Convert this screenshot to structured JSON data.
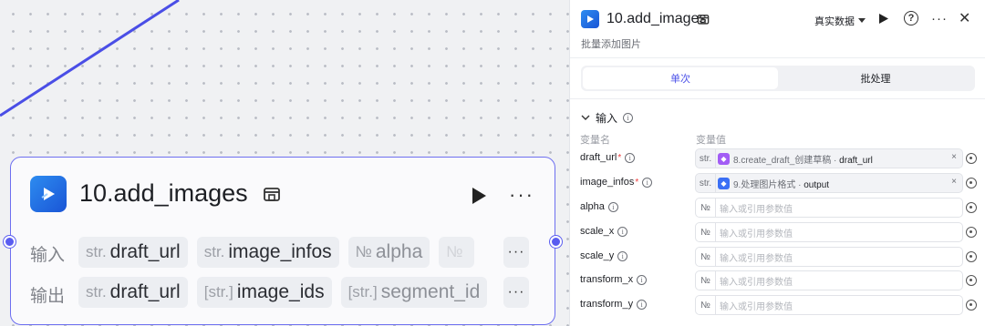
{
  "node": {
    "title": "10.add_images",
    "more": "···",
    "input_label": "输入",
    "output_label": "输出",
    "inputs": [
      {
        "type": "str.",
        "name": "draft_url"
      },
      {
        "type": "str.",
        "name": "image_infos"
      },
      {
        "type": "№",
        "name": "alpha"
      },
      {
        "type": "№",
        "name": ""
      }
    ],
    "outputs": [
      {
        "type": "str.",
        "name": "draft_url"
      },
      {
        "type": "[str.]",
        "name": "image_ids"
      },
      {
        "type": "[str.]",
        "name": "segment_id"
      }
    ],
    "row_more": "···"
  },
  "panel": {
    "title": "10.add_images",
    "subtitle": "批量添加图片",
    "data_source": "真实数据",
    "help": "?",
    "more": "···",
    "close": "✕",
    "tabs": [
      {
        "label": "单次",
        "active": true
      },
      {
        "label": "批处理",
        "active": false
      }
    ],
    "section": "输入",
    "col_name": "变量名",
    "col_value": "变量值",
    "params": [
      {
        "name": "draft_url",
        "required": true,
        "type": "str.",
        "ref_node": "8.create_draft_创建草稿",
        "ref_sep": "·",
        "ref_field": "draft_url",
        "ref_color": "#a25cf5",
        "clear": "×"
      },
      {
        "name": "image_infos",
        "required": true,
        "type": "str.",
        "ref_node": "9.处理图片格式",
        "ref_sep": "·",
        "ref_field": "output",
        "ref_color": "#3b6ff5",
        "clear": "×"
      },
      {
        "name": "alpha",
        "type": "№",
        "placeholder": "输入或引用参数值"
      },
      {
        "name": "scale_x",
        "type": "№",
        "placeholder": "输入或引用参数值"
      },
      {
        "name": "scale_y",
        "type": "№",
        "placeholder": "输入或引用参数值"
      },
      {
        "name": "transform_x",
        "type": "№",
        "placeholder": "输入或引用参数值"
      },
      {
        "name": "transform_y",
        "type": "№",
        "placeholder": "输入或引用参数值"
      }
    ]
  }
}
